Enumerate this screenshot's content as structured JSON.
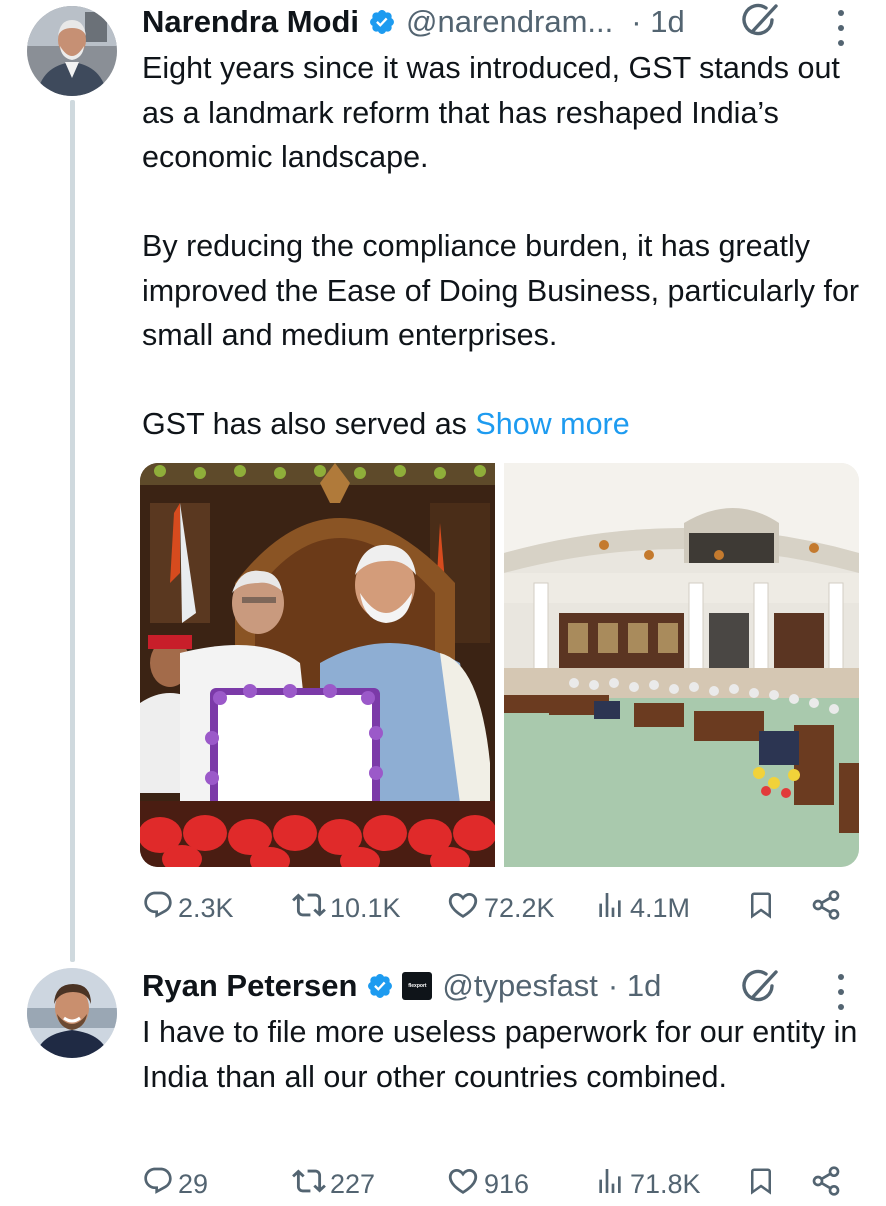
{
  "tweet1": {
    "author_name": "Narendra Modi",
    "handle": "@narendram...",
    "time": "· 1d",
    "paragraphs": [
      "Eight years since it was introduced, GST stands out as a landmark reform that has reshaped India’s economic landscape.",
      "By reducing the compliance burden, it has greatly improved the Ease of Doing Business, particularly for small and medium enterprises."
    ],
    "truncated_text": "GST has also served as ",
    "show_more": "Show more",
    "stats": {
      "replies": "2.3K",
      "reposts": "10.1K",
      "likes": "72.2K",
      "views": "4.1M"
    }
  },
  "tweet2": {
    "author_name": "Ryan Petersen",
    "affiliate_badge": "flexport",
    "handle": "@typesfast",
    "time": "· 1d",
    "text": "I have to file more useless paperwork for our entity in India than all our other countries combined.",
    "stats": {
      "replies": "29",
      "reposts": "227",
      "likes": "916",
      "views": "71.8K"
    }
  },
  "colors": {
    "accent": "#1d9bf0",
    "muted": "#536471",
    "text": "#0f1419",
    "thread_line": "#cfd9de"
  },
  "icons": [
    "verified-badge-icon",
    "grok-icon",
    "more-options-icon",
    "reply-icon",
    "repost-icon",
    "like-icon",
    "views-icon",
    "bookmark-icon",
    "share-icon"
  ]
}
